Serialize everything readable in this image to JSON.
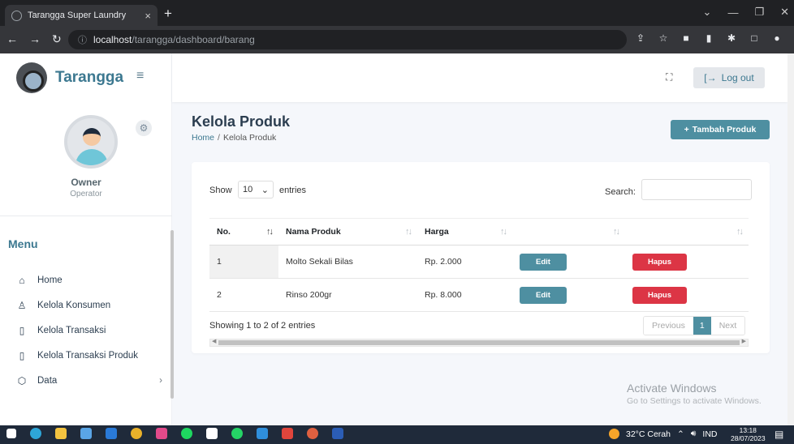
{
  "browser": {
    "tab_title": "Tarangga Super Laundry",
    "tab_close": "×",
    "new_tab": "+",
    "url_host": "localhost",
    "url_path": "/tarangga/dashboard/barang",
    "window_controls": [
      "⌄",
      "—",
      "❐",
      "✕"
    ]
  },
  "sidebar": {
    "brand": "Tarangga",
    "user_name": "Owner",
    "user_role": "Operator",
    "menu_heading": "Menu",
    "items": [
      {
        "label": "Home",
        "icon": "home-icon"
      },
      {
        "label": "Kelola Konsumen",
        "icon": "user-icon"
      },
      {
        "label": "Kelola Transaksi",
        "icon": "file-icon"
      },
      {
        "label": "Kelola Transaksi Produk",
        "icon": "file-icon"
      },
      {
        "label": "Data",
        "icon": "box-icon"
      }
    ]
  },
  "header": {
    "logout_label": "Log out"
  },
  "main": {
    "title": "Kelola Produk",
    "breadcrumb_home": "Home",
    "breadcrumb_sep": "/",
    "breadcrumb_current": "Kelola Produk",
    "add_button": "Tambah Produk",
    "show_label": "Show",
    "page_length": "10",
    "entries_label": "entries",
    "search_label": "Search:",
    "columns": [
      "No.",
      "Nama Produk",
      "Harga",
      "",
      ""
    ],
    "rows": [
      {
        "no": "1",
        "name": "Molto Sekali Bilas",
        "price": "Rp. 2.000",
        "edit": "Edit",
        "delete": "Hapus"
      },
      {
        "no": "2",
        "name": "Rinso 200gr",
        "price": "Rp. 8.000",
        "edit": "Edit",
        "delete": "Hapus"
      }
    ],
    "info": "Showing 1 to 2 of 2 entries",
    "pager_prev": "Previous",
    "pager_current": "1",
    "pager_next": "Next"
  },
  "watermark": {
    "line1": "Activate Windows",
    "line2": "Go to Settings to activate Windows."
  },
  "taskbar": {
    "weather": "32°C Cerah",
    "lang": "IND",
    "time": "13:18",
    "date": "28/07/2023"
  },
  "colors": {
    "accent": "#4e8fa1",
    "danger": "#dc3545",
    "brand": "#3c7890"
  }
}
